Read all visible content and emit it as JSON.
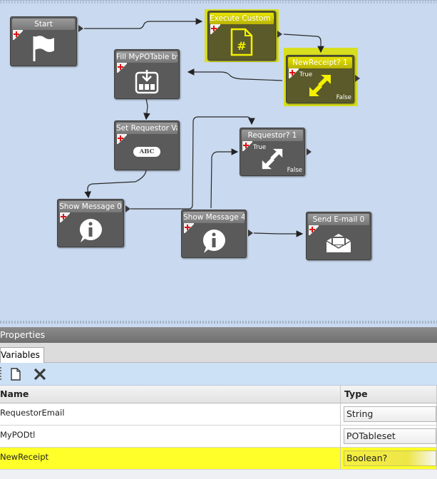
{
  "workflow": {
    "nodes": {
      "start": {
        "title": "Start",
        "icon": "flag-icon"
      },
      "execute": {
        "title": "Execute Custom Code",
        "icon": "code-file-icon"
      },
      "newreceipt": {
        "title": "NewReceipt? 1",
        "true_label": "True",
        "false_label": "False",
        "icon": "diagonal-arrows-icon"
      },
      "fill": {
        "title": "Fill MyPOTable by Query",
        "icon": "download-tray-icon"
      },
      "setreq": {
        "title": "Set Requestor Variable",
        "icon": "abc-icon",
        "icon_text": "ABC"
      },
      "requestor": {
        "title": "Requestor? 1",
        "true_label": "True",
        "false_label": "False",
        "icon": "diagonal-arrows-icon"
      },
      "show0": {
        "title": "Show Message 0",
        "icon": "info-icon"
      },
      "show4": {
        "title": "Show Message 4",
        "icon": "info-icon"
      },
      "email": {
        "title": "Send E-mail 0",
        "icon": "envelope-icon"
      }
    },
    "highlight_color": "#d8df1e"
  },
  "properties": {
    "header": "Properties",
    "tab": "Variables",
    "toolbar": {
      "new_icon": "new-document-icon",
      "delete_icon": "delete-x-icon"
    },
    "columns": {
      "name": "Name",
      "type": "Type"
    },
    "rows": [
      {
        "name": "RequestorEmail",
        "type": "String",
        "selected": false
      },
      {
        "name": "MyPODtl",
        "type": "POTableset",
        "selected": false
      },
      {
        "name": "NewReceipt",
        "type": "Boolean?",
        "selected": true
      }
    ]
  }
}
